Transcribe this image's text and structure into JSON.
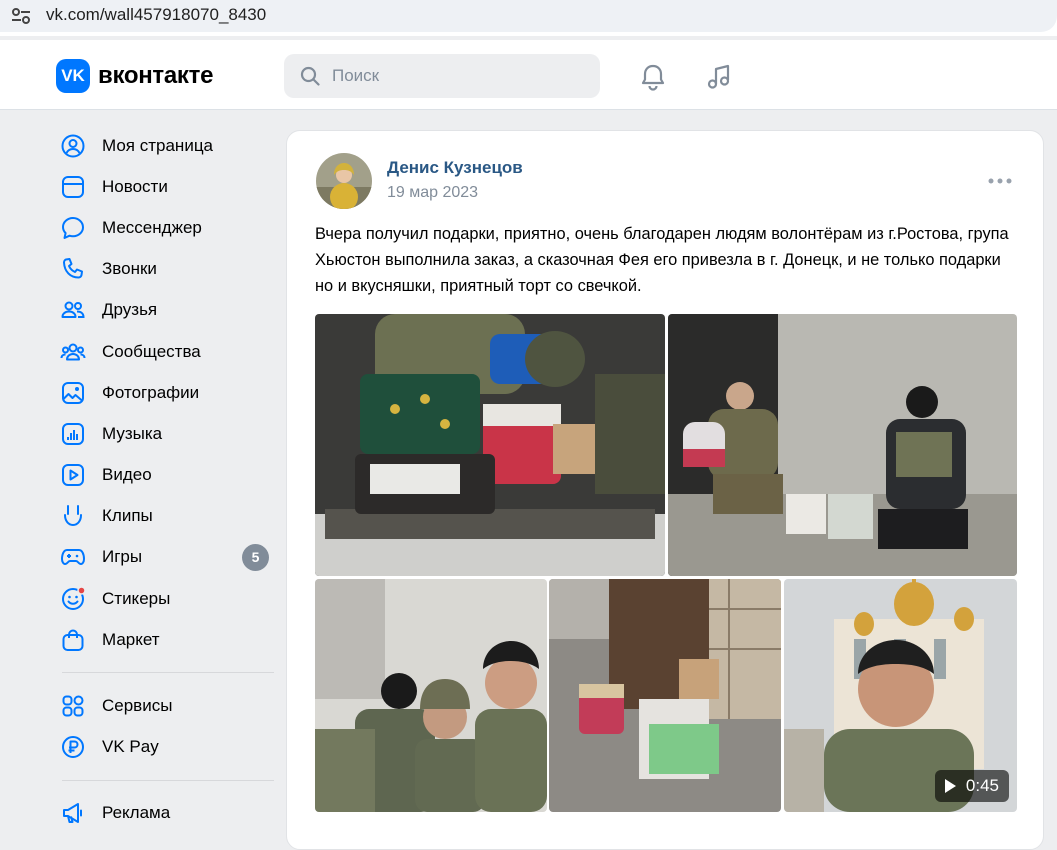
{
  "browser": {
    "url": "vk.com/wall457918070_8430"
  },
  "header": {
    "brand": "вконтакте",
    "logo_letters": "VK",
    "search_placeholder": "Поиск"
  },
  "sidebar": {
    "items": [
      {
        "label": "Моя страница",
        "icon": "user-circle-icon"
      },
      {
        "label": "Новости",
        "icon": "news-icon"
      },
      {
        "label": "Мессенджер",
        "icon": "message-icon"
      },
      {
        "label": "Звонки",
        "icon": "phone-icon"
      },
      {
        "label": "Друзья",
        "icon": "friends-icon"
      },
      {
        "label": "Сообщества",
        "icon": "communities-icon"
      },
      {
        "label": "Фотографии",
        "icon": "photo-icon"
      },
      {
        "label": "Музыка",
        "icon": "music-icon"
      },
      {
        "label": "Видео",
        "icon": "video-icon"
      },
      {
        "label": "Клипы",
        "icon": "clips-icon"
      },
      {
        "label": "Игры",
        "icon": "games-icon",
        "badge": "5"
      },
      {
        "label": "Стикеры",
        "icon": "stickers-icon"
      },
      {
        "label": "Маркет",
        "icon": "market-icon"
      }
    ],
    "items2": [
      {
        "label": "Сервисы",
        "icon": "services-icon"
      },
      {
        "label": "VK Pay",
        "icon": "vkpay-icon"
      }
    ],
    "items3": [
      {
        "label": "Реклама",
        "icon": "ads-icon"
      }
    ]
  },
  "post": {
    "author": "Денис Кузнецов",
    "date": "19 мар 2023",
    "text": "Вчера получил подарки, приятно, очень благодарен людям волонтёрам из г.Ростова, група Хьюстон выполнила заказ, а сказочная Фея его привезла в г. Донецк, и не только подарки но и вкусняшки, приятный торт со свечкой.",
    "video_duration": "0:45"
  },
  "colors": {
    "accent": "#0077ff",
    "author": "#2a5885",
    "secondary": "#818c99",
    "badge": "#818c99",
    "background": "#edeef0"
  }
}
